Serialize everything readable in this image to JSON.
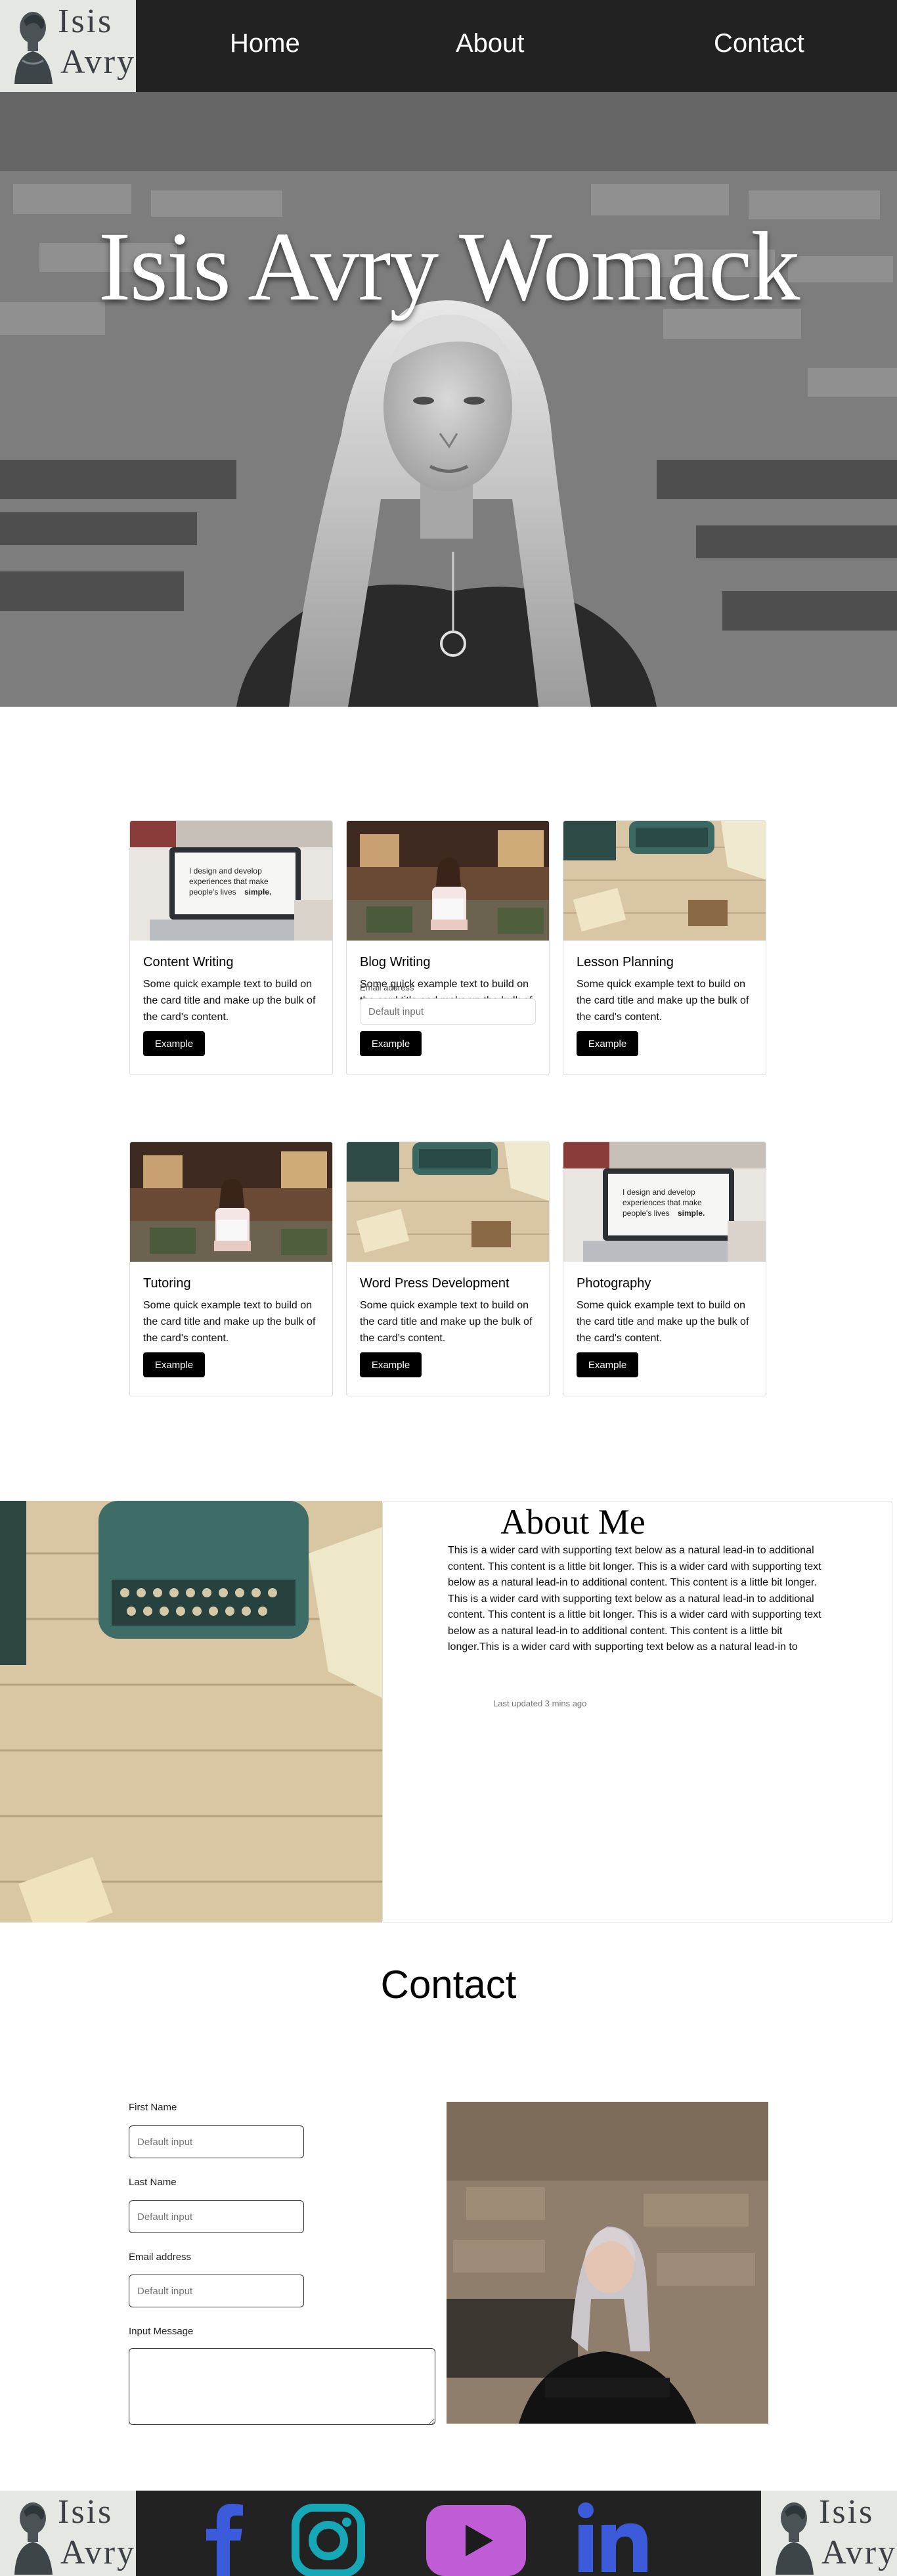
{
  "logo": {
    "line1": "Isis",
    "line2": "Avry",
    "icon": "bust-statue-icon"
  },
  "nav": {
    "home": "Home",
    "about": "About",
    "contact": "Contact"
  },
  "hero": {
    "title": "Isis Avry Womack"
  },
  "cards": [
    {
      "title": "Content Writing",
      "text": "Some quick example text to build on the card title and make up the bulk of the card's content.",
      "button": "Example",
      "image": "laptop-design-photo"
    },
    {
      "title": "Blog Writing",
      "text": "Some quick example text to build on the card title and make up the bulk of the card's content.",
      "button": "Example",
      "image": "woman-with-laptop-photo",
      "overlay_label": "Email address",
      "overlay_placeholder": "Default input"
    },
    {
      "title": "Lesson Planning",
      "text": "Some quick example text to build on the card title and make up the bulk of the card's content.",
      "button": "Example",
      "image": "typewriter-desk-photo"
    },
    {
      "title": "Tutoring",
      "text": "Some quick example text to build on the card title and make up the bulk of the card's content.",
      "button": "Example",
      "image": "woman-with-laptop-photo"
    },
    {
      "title": "Word Press Development",
      "text": "Some quick example text to build on the card title and make up the bulk of the card's content.",
      "button": "Example",
      "image": "typewriter-desk-photo"
    },
    {
      "title": "Photography",
      "text": "Some quick example text to build on the card title and make up the bulk of the card's content.",
      "button": "Example",
      "image": "laptop-design-photo"
    }
  ],
  "laptop_screen_text": {
    "l1": "I design and develop",
    "l2": "experiences that make",
    "l3": "people's lives",
    "l4": "simple."
  },
  "about": {
    "title": "About Me",
    "text": "This is a wider card with supporting text below as a natural lead-in to additional content. This content is a little bit longer. This is a wider card with supporting text below as a natural lead-in to additional content. This content is a little bit longer.\nThis is a wider card with supporting text below as a natural lead-in to additional content. This content is a little bit longer. This is a wider card with supporting text below as a natural lead-in to additional content. This content is a little bit longer.This is a wider card with supporting text below as a natural lead-in to",
    "updated": "Last updated 3 mins ago"
  },
  "contact": {
    "title": "Contact",
    "first_name_label": "First Name",
    "last_name_label": "Last Name",
    "email_label": "Email address",
    "message_label": "Input Message",
    "placeholder": "Default input"
  },
  "footer": {
    "icons": [
      "facebook-icon",
      "instagram-icon",
      "youtube-icon",
      "linkedin-icon"
    ],
    "colors": {
      "facebook": "#3b5bdb",
      "instagram": "#17a8b8",
      "youtube": "#c05cd6",
      "linkedin": "#3b5bdb"
    }
  },
  "colors": {
    "header_bg": "#222222",
    "logo_bg": "#e4e7e2",
    "button_bg": "#000000"
  }
}
